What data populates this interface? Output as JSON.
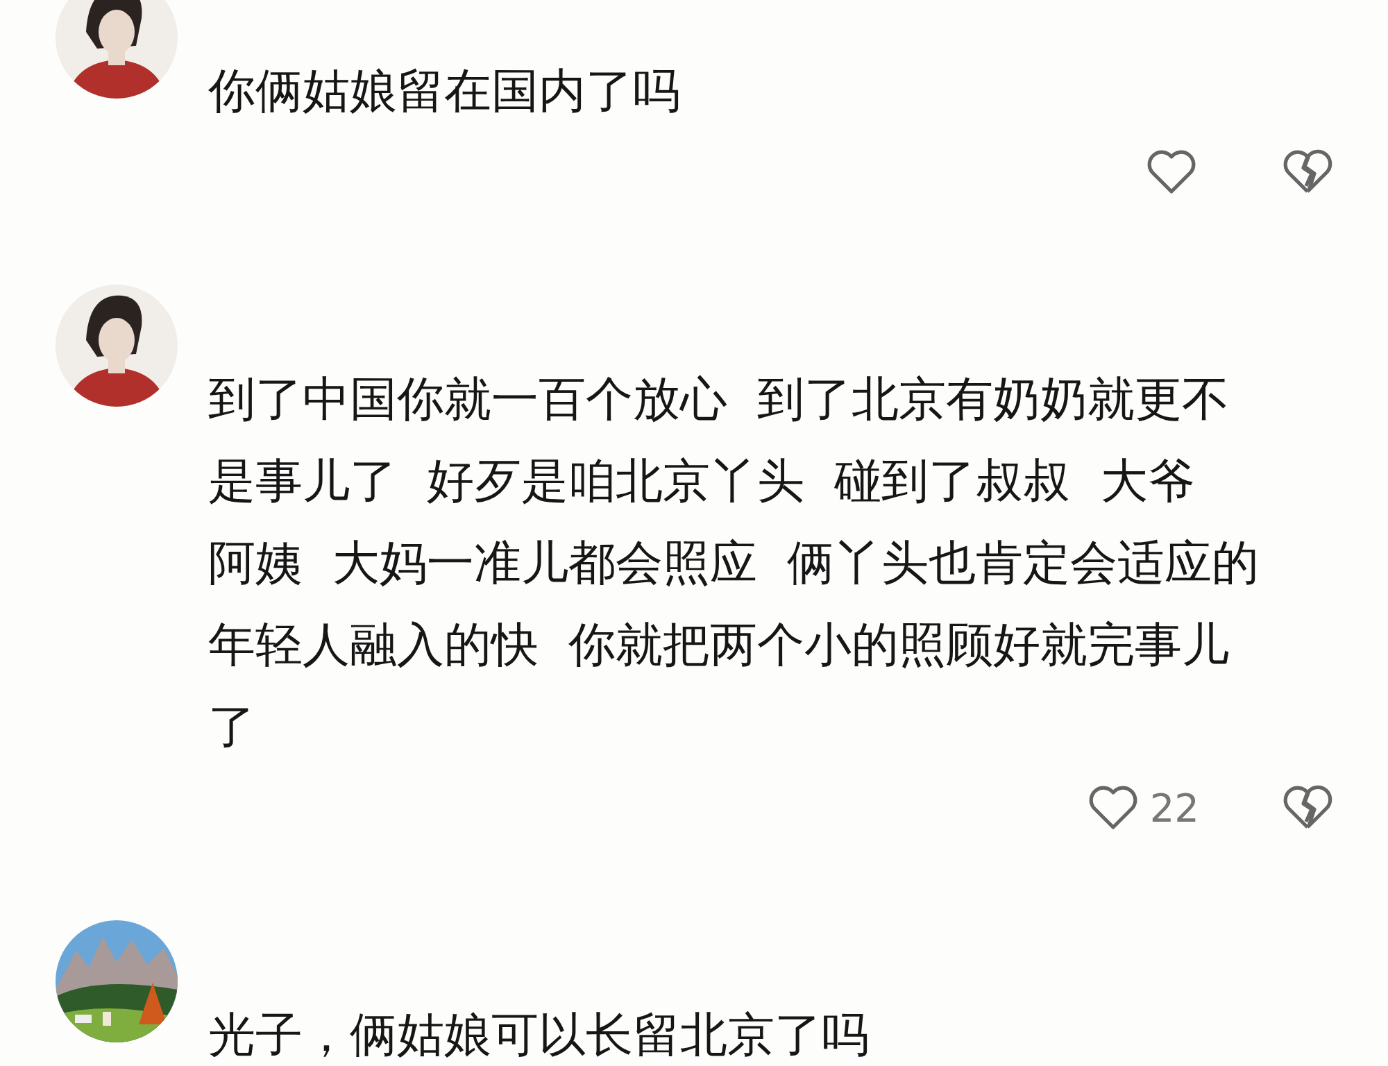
{
  "comments": [
    {
      "avatar": {
        "kind": "portrait"
      },
      "lines": [
        "你俩姑娘留在国内了吗"
      ],
      "actions": true
    },
    {
      "avatar": {
        "kind": "portrait"
      },
      "lines": [
        "到了中国你就一百个放心  到了北京有奶奶就更不",
        "是事儿了  好歹是咱北京丫头  碰到了叔叔  大爷",
        "阿姨  大妈一准儿都会照应  俩丫头也肯定会适应的",
        "年轻人融入的快  你就把两个小的照顾好就完事儿",
        "了"
      ],
      "actions": true,
      "like_count": "22"
    },
    {
      "avatar": {
        "kind": "landscape"
      },
      "lines": [
        "光子，俩姑娘可以长留北京了吗"
      ],
      "actions": false
    }
  ]
}
